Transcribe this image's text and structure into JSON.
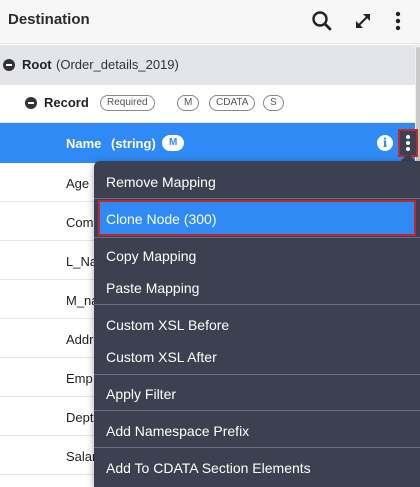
{
  "header": {
    "title": "Destination",
    "icons": [
      "search-icon",
      "expand-icon",
      "more-vertical-icon"
    ]
  },
  "tree": {
    "root": {
      "label": "Root",
      "detail": "(Order_details_2019)"
    },
    "record": {
      "label": "Record",
      "badges": [
        "Required",
        "M",
        "CDATA",
        "S"
      ]
    },
    "selected": {
      "label": "Name",
      "type": "(string)",
      "badge": "M"
    },
    "fields": [
      "Age",
      "Com",
      "L_Na",
      "M_na",
      "Addr",
      "Emp",
      "Dept",
      "Salar"
    ]
  },
  "context_menu": {
    "items": [
      "Remove Mapping",
      "Clone Node (300)",
      "Copy Mapping",
      "Paste Mapping",
      "Custom XSL Before",
      "Custom XSL After",
      "Apply Filter",
      "Add Namespace Prefix",
      "Add To CDATA Section Elements"
    ],
    "highlighted": "Clone Node (300)"
  },
  "colors": {
    "selected_row": "#2f8af5",
    "menu_bg": "#3b4150",
    "highlight_border": "#c0282d",
    "root_row_bg": "#e3e5ea"
  }
}
